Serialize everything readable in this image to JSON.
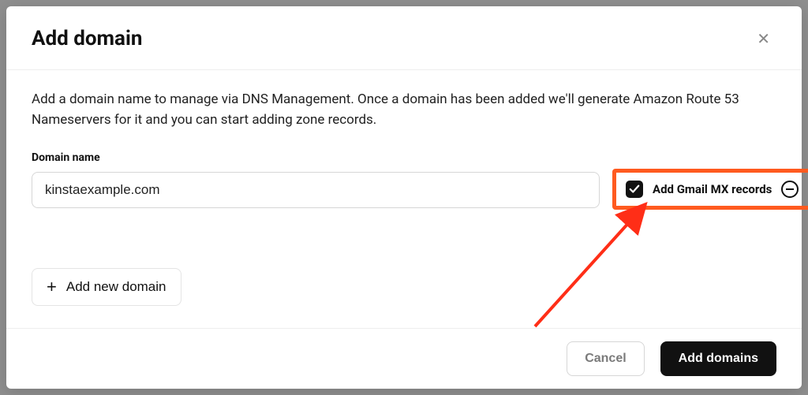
{
  "modal": {
    "title": "Add domain",
    "description": "Add a domain name to manage via DNS Management. Once a domain has been added we'll generate Amazon Route 53 Nameservers for it and you can start adding zone records.",
    "field_label": "Domain name",
    "domain_value": "kinstaexample.com",
    "mx_checkbox_label": "Add Gmail MX records",
    "mx_checked": true,
    "add_new_label": "Add new domain",
    "footer": {
      "cancel": "Cancel",
      "submit": "Add domains"
    }
  },
  "annotation": {
    "highlight_color": "#ff5a1f",
    "arrow_color": "#ff2e17"
  }
}
